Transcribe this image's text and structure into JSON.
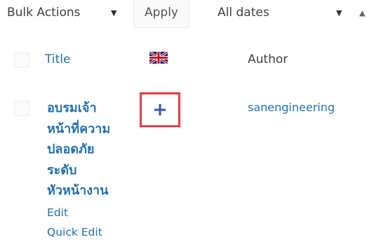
{
  "toolbar": {
    "bulk_actions": "Bulk Actions",
    "apply_label": "Apply",
    "dates_filter": "All dates",
    "caret_icon": "caret-down-icon"
  },
  "table": {
    "columns": {
      "title": "Title",
      "language_icon": "uk-flag-icon",
      "author": "Author"
    },
    "rows": [
      {
        "title_lines": [
          "อบรมเจ้า",
          "หน้าที่ความ",
          "ปลอดภัย",
          "ระดับ",
          "หัวหน้างาน"
        ],
        "actions": {
          "edit": "Edit",
          "quick_edit": "Quick Edit"
        },
        "translation_add": "+",
        "author": "sanengineering"
      }
    ]
  },
  "colors": {
    "link": "#2271b1",
    "highlight": "#e63d4a",
    "plus": "#3858a8"
  }
}
